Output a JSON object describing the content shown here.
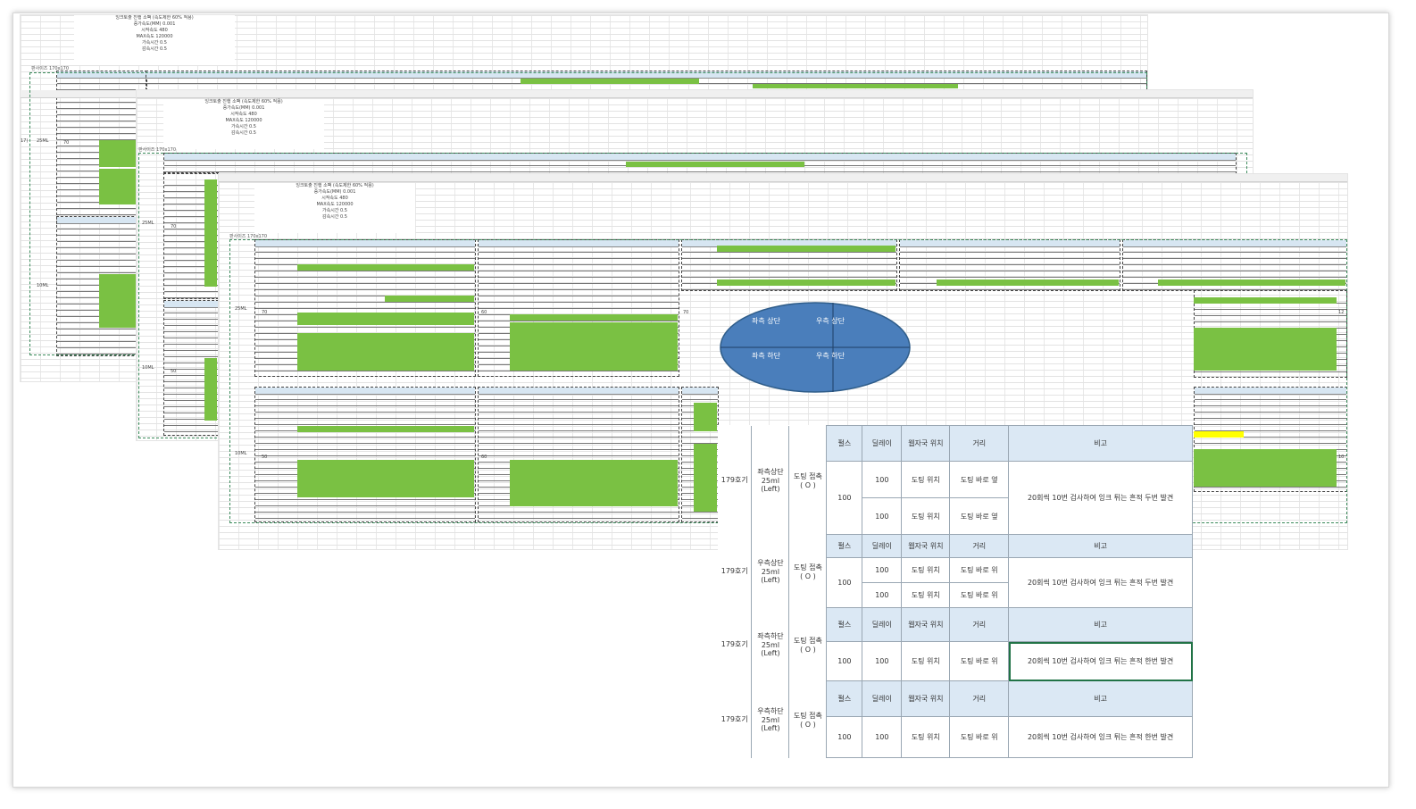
{
  "colors": {
    "highlight_green": "#7ac143",
    "header_blue": "#dbe8f4",
    "ellipse": "#4a7ebb",
    "highlight_yellow": "#ffff00"
  },
  "params": {
    "title": "잉크토출 진행 소팩 (속도제한 60% 적용)",
    "accel": "증가속도(MM) 0.001",
    "start": "시작속도 480",
    "max": "MAX속도 120000",
    "accel_time": "가속시간 0.5",
    "decel_time": "감속시간 0.5"
  },
  "sheet_tag": "판사이즈 170x170",
  "labels": {
    "row_17": "17)",
    "ml_25": "25ML",
    "ml_10": "10ML",
    "v_70": "70",
    "v_50": "50",
    "v_60": "60",
    "v_12": "12",
    "v_10": "10"
  },
  "ellipse": {
    "tl": "좌측 상단",
    "tr": "우측 상단",
    "bl": "좌측 하단",
    "br": "우측 하단"
  },
  "results": {
    "headers": [
      "펄스",
      "딜레이",
      "웹자국 위치",
      "거리",
      "비고"
    ],
    "groups": [
      {
        "machine": "179호기",
        "position": [
          "좌측상단",
          "25ml",
          "(Left)"
        ],
        "contact": [
          "도팅 접촉",
          "( O )"
        ],
        "pulse": "100",
        "rows": [
          {
            "delay": "100",
            "mark": "도팅 위치",
            "distance": "도팅 바로 옆"
          },
          {
            "delay": "100",
            "mark": "도팅 위치",
            "distance": "도팅 바로 옆"
          }
        ],
        "note": "20회씩 10번 검사하여 잉크 튀는 흔적 두번 발견"
      },
      {
        "machine": "179호기",
        "position": [
          "우측상단",
          "25ml",
          "(Left)"
        ],
        "contact": [
          "도팅 접촉",
          "( O )"
        ],
        "pulse": "100",
        "rows": [
          {
            "delay": "100",
            "mark": "도팅 위치",
            "distance": "도팅 바로 위"
          },
          {
            "delay": "100",
            "mark": "도팅 위치",
            "distance": "도팅 바로 위"
          }
        ],
        "note": "20회씩 10번 검사하여 잉크 튀는 흔적 두번 발견"
      },
      {
        "machine": "179호기",
        "position": [
          "좌측하단",
          "25ml",
          "(Left)"
        ],
        "contact": [
          "도팅 접촉",
          "( O )"
        ],
        "pulse": "100",
        "rows": [
          {
            "delay": "100",
            "mark": "도팅 위치",
            "distance": "도팅 바로 위"
          }
        ],
        "note": "20회씩 10번 검사하여 잉크 튀는 흔적 한번 발견"
      },
      {
        "machine": "179호기",
        "position": [
          "우측하단",
          "25ml",
          "(Left)"
        ],
        "contact": [
          "도팅 접촉",
          "( O )"
        ],
        "pulse": "100",
        "rows": [
          {
            "delay": "100",
            "mark": "도팅 위치",
            "distance": "도팅 바로 위"
          }
        ],
        "note": "20회씩 10번 검사하여 잉크 튀는 흔적 한번 발견"
      }
    ]
  }
}
